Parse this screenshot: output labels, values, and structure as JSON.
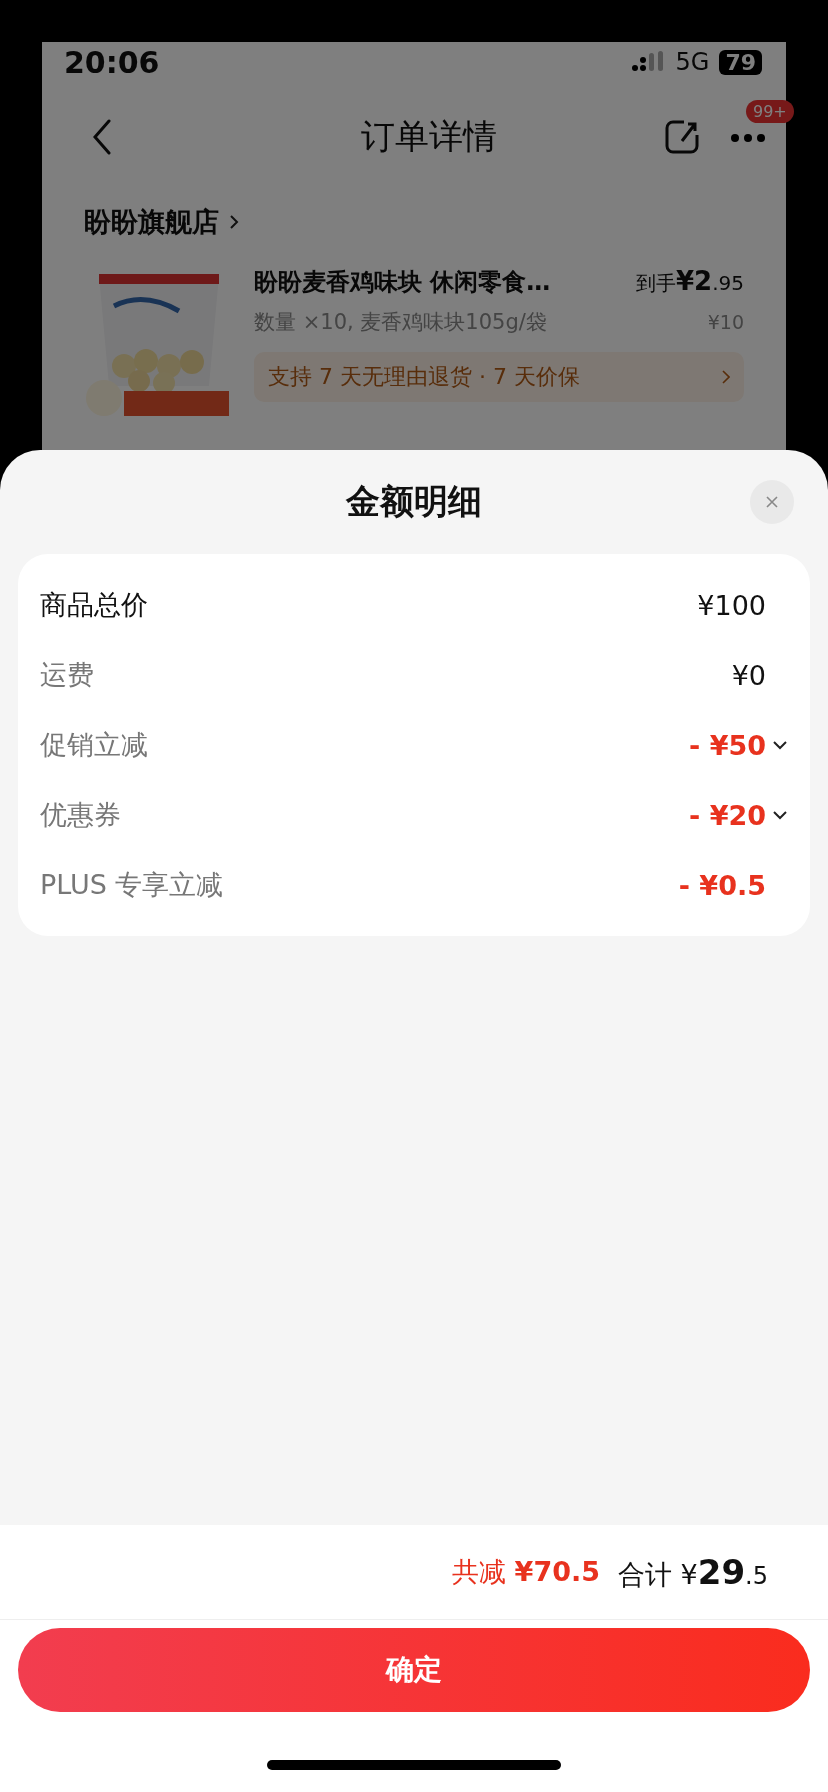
{
  "status_bar": {
    "time": "20:06",
    "network": "5G",
    "battery": "79"
  },
  "background_page": {
    "title": "订单详情",
    "badge": "99+",
    "store": "盼盼旗舰店",
    "product": {
      "name": "盼盼麦香鸡味块 休闲零食…",
      "spec": "数量 ×10, 麦香鸡味块105g/袋",
      "price_label": "到手",
      "price": "¥2.95",
      "original_price": "¥10",
      "service": "支持 7 天无理由退货 · 7 天价保"
    }
  },
  "sheet": {
    "title": "金额明细",
    "rows": [
      {
        "label": "商品总价",
        "value": "¥100",
        "kind": "subtotal",
        "expandable": false
      },
      {
        "label": "运费",
        "value": "¥0",
        "kind": "fee",
        "expandable": false
      },
      {
        "label": "促销立减",
        "value": "- ¥50",
        "kind": "discount",
        "expandable": true
      },
      {
        "label": "优惠券",
        "value": "- ¥20",
        "kind": "discount",
        "expandable": true
      },
      {
        "label": "PLUS 专享立减",
        "value": "- ¥0.5",
        "kind": "discount",
        "expandable": false
      }
    ],
    "saved_label": "共减",
    "saved": "¥70.5",
    "total_label": "合计",
    "total": "¥29.5",
    "confirm": "确定"
  }
}
